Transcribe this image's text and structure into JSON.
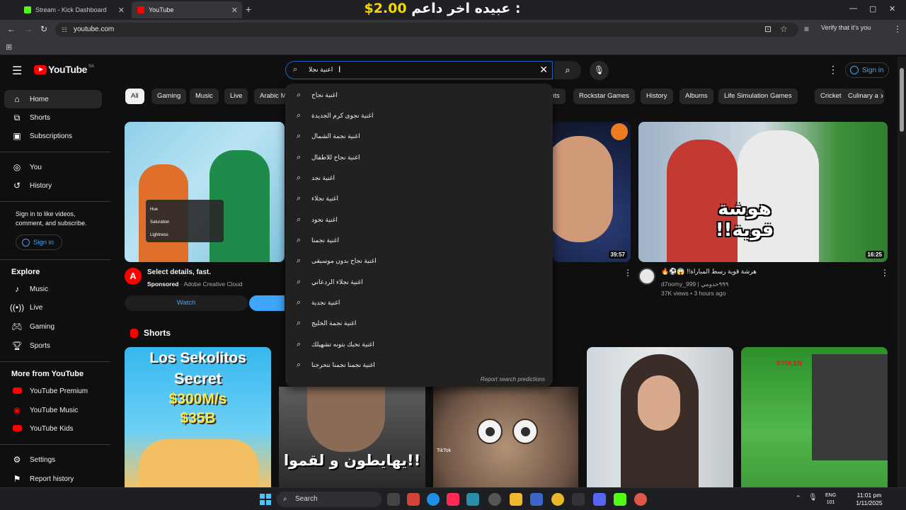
{
  "browser": {
    "tabs": [
      {
        "label": "Stream - Kick Dashboard",
        "favicon_color": "#53fc18"
      },
      {
        "label": "YouTube",
        "favicon_color": "#ff0000"
      }
    ],
    "new_tab": "+",
    "overlay_text": "عبيده اخر داعم :",
    "overlay_amount": "$2.00",
    "url": "youtube.com",
    "verify_text": "Verify that it's you",
    "window_controls": {
      "minimize": "—",
      "maximize": "▢",
      "close": "✕"
    }
  },
  "header": {
    "logo_text": "YouTube",
    "country_code": "SA",
    "search_value": "اعنية نجلا",
    "sign_in": "Sign in"
  },
  "suggestions": [
    "اغنية نجاح",
    "اغنية نجوى كرم الجديدة",
    "اغنية نجمة الشمال",
    "اغنية نجاح للاطفال",
    "اغنية نجد",
    "اغنية نجلاء",
    "اغنية نجود",
    "اغنية نجمنا",
    "اغنية نجاح بدون موسيقى",
    "اغنية نجلاء الردعاني",
    "اغنية نجدية",
    "اغنية نجمة الخليج",
    "اغنية نحبك بتونه تشهيلك",
    "اغنية نجمنا نجمنا نتحرجنا"
  ],
  "report_predictions": "Report search predictions",
  "sidebar": {
    "main": [
      {
        "label": "Home",
        "icon": "home-icon"
      },
      {
        "label": "Shorts",
        "icon": "shorts-icon"
      },
      {
        "label": "Subscriptions",
        "icon": "subscriptions-icon"
      }
    ],
    "you": [
      {
        "label": "You",
        "icon": "you-icon"
      },
      {
        "label": "History",
        "icon": "history-icon"
      }
    ],
    "signin_text": "Sign in to like videos, comment, and subscribe.",
    "signin_button": "Sign in",
    "explore_title": "Explore",
    "explore": [
      {
        "label": "Music",
        "icon": "music-icon"
      },
      {
        "label": "Live",
        "icon": "live-icon"
      },
      {
        "label": "Gaming",
        "icon": "gaming-icon"
      },
      {
        "label": "Sports",
        "icon": "sports-icon"
      }
    ],
    "more_title": "More from YouTube",
    "more": [
      {
        "label": "YouTube Premium"
      },
      {
        "label": "YouTube Music"
      },
      {
        "label": "YouTube Kids"
      }
    ],
    "bottom": [
      {
        "label": "Settings",
        "icon": "gear-icon"
      },
      {
        "label": "Report history",
        "icon": "flag-icon"
      }
    ]
  },
  "chips": [
    "All",
    "Gaming",
    "Music",
    "Live",
    "Arabic M",
    "nts",
    "Rockstar Games",
    "History",
    "Albums",
    "Life Simulation Games",
    "Cricket",
    "Culinary a"
  ],
  "ad": {
    "title": "Select details, fast.",
    "sponsored": "Sponsored",
    "advertiser": "Adobe Creative Cloud",
    "watch": "Watch",
    "panel_hue": "Hue",
    "panel_saturation": "Saturation",
    "panel_lightness": "Lightness"
  },
  "videos": [
    {
      "duration": "39:57"
    },
    {
      "duration": "16:25",
      "title": "هرشة قوية رسط المباراة!! 😱⚽🔥",
      "channel": "d7oomy_999 | ٩٩٩حدومي",
      "meta": "37K views • 3 hours ago",
      "thumb_text": "هوشة قوية!!"
    }
  ],
  "shorts": {
    "title": "Shorts",
    "items": [
      {
        "line1": "Los Sekolitos",
        "line2": "Secret",
        "line3": "$300M/s",
        "line4": "$35B"
      },
      {
        "text": "!!يهايطون و لقموا"
      },
      {
        "tiktok": "TikTok"
      },
      {},
      {
        "text": "STOLEN"
      }
    ]
  },
  "taskbar": {
    "search": "Search",
    "time": "11:01 pm",
    "date": "1/11/2025",
    "lang_top": "ENG",
    "lang_bottom": "101"
  }
}
